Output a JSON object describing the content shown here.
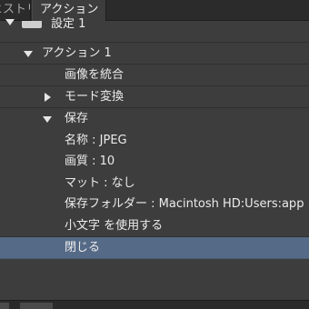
{
  "tabs": {
    "history_label": "ヒストリー",
    "actions_label": "アクション"
  },
  "set": {
    "label": "設定 1"
  },
  "action": {
    "label": "アクション 1"
  },
  "steps": [
    {
      "label": "画像を統合"
    },
    {
      "label": "モード変換"
    },
    {
      "label": "保存"
    }
  ],
  "save_details": [
    {
      "label": "名称 : JPEG"
    },
    {
      "label": "画質 : 10"
    },
    {
      "label": "マット : なし"
    },
    {
      "label": "保存フォルダー : Macintosh HD:Users:app"
    },
    {
      "label": "小文字 を使用する"
    }
  ],
  "close_step": {
    "label": "閉じる"
  },
  "colors": {
    "panel_bg": "#3d3d3d",
    "selected_row": "#556a86",
    "tab_bar": "#2b2b2b",
    "text": "#ececec"
  }
}
